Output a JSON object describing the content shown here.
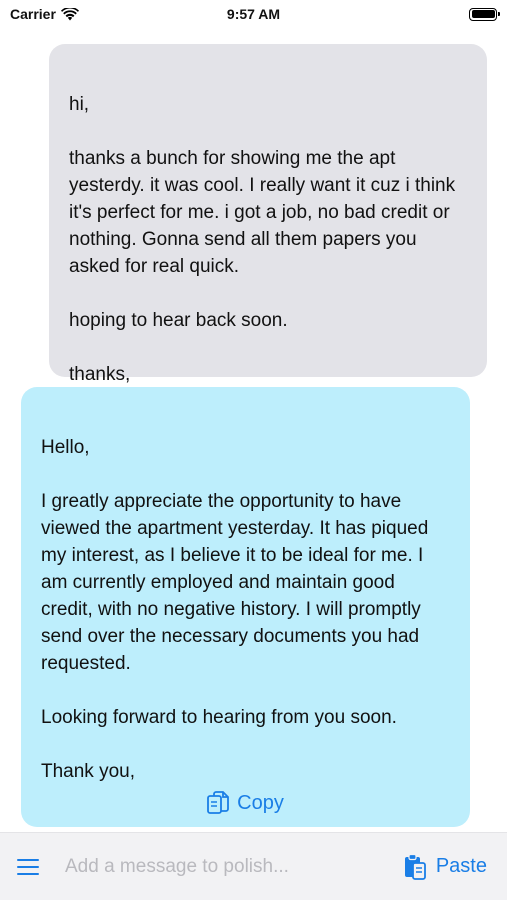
{
  "status_bar": {
    "carrier": "Carrier",
    "time": "9:57 AM",
    "wifi_icon": "wifi-icon",
    "battery_icon": "battery-icon"
  },
  "messages": [
    {
      "role": "user",
      "text": "hi,\n\nthanks a bunch for showing me the apt yesterdy. it was cool. I really want it cuz i think it's perfect for me. i got a job, no bad credit or nothing. Gonna send all them papers you asked for real quick.\n\nhoping to hear back soon.\n\nthanks,"
    },
    {
      "role": "assistant",
      "text": "Hello,\n\nI greatly appreciate the opportunity to have viewed the apartment yesterday. It has piqued my interest, as I believe it to be ideal for me. I am currently employed and maintain good credit, with no negative history. I will promptly send over the necessary documents you had requested.\n\nLooking forward to hearing from you soon.\n\nThank you,",
      "copy_label": "Copy",
      "copy_icon": "copy-icon"
    }
  ],
  "composer": {
    "menu_icon": "menu-icon",
    "placeholder": "Add a message to polish...",
    "value": "",
    "paste_label": "Paste",
    "paste_icon": "clipboard-icon"
  },
  "colors": {
    "accent": "#1a7ee6",
    "incoming_bubble": "#e3e3e8",
    "outgoing_bubble": "#bdeefc",
    "composer_bg": "#f2f2f4"
  }
}
